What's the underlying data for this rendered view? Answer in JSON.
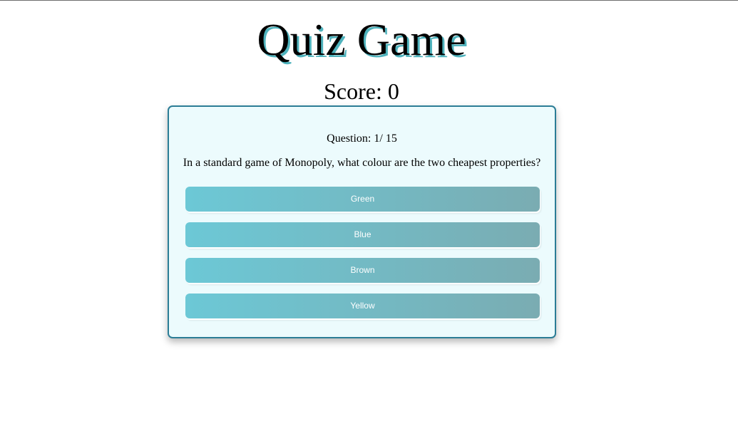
{
  "page": {
    "title": "Quiz Game",
    "score_label": "Score: 0"
  },
  "quiz": {
    "question_number": "Question: 1/ 15",
    "question_text": "In a standard game of Monopoly, what colour are the two cheapest properties?",
    "answers": [
      {
        "label": "Green"
      },
      {
        "label": "Blue"
      },
      {
        "label": "Brown"
      },
      {
        "label": "Yellow"
      }
    ]
  },
  "colors": {
    "title_shadow": "#4fb3bd",
    "card_border": "#2c7d96",
    "card_background": "#ecfbfd",
    "button_gradient_start": "#6cc8d6",
    "button_gradient_end": "#7aacb2"
  }
}
